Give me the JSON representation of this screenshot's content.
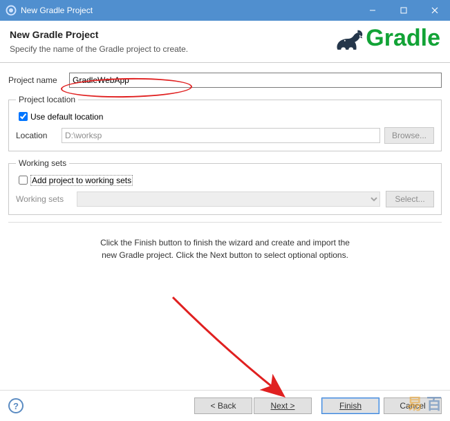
{
  "window": {
    "title": "New Gradle Project"
  },
  "header": {
    "title": "New Gradle Project",
    "subtitle": "Specify the name of the Gradle project to create.",
    "logo_text": "Gradle"
  },
  "project_name": {
    "label": "Project name",
    "value": "GradleWebApp"
  },
  "project_location": {
    "legend": "Project location",
    "use_default_label": "Use default location",
    "use_default_checked": true,
    "location_label": "Location",
    "location_value": "D:\\worksp",
    "browse_label": "Browse..."
  },
  "working_sets": {
    "legend": "Working sets",
    "add_label": "Add project to working sets",
    "add_checked": false,
    "list_label": "Working sets",
    "select_label": "Select..."
  },
  "hint": {
    "line1": "Click the Finish button to finish the wizard and create and import the",
    "line2": "new Gradle project. Click the Next button to select optional options."
  },
  "footer": {
    "back": "< Back",
    "next": "Next >",
    "finish": "Finish",
    "cancel": "Cancel"
  },
  "watermark": {
    "a": "易",
    "b": "百"
  }
}
